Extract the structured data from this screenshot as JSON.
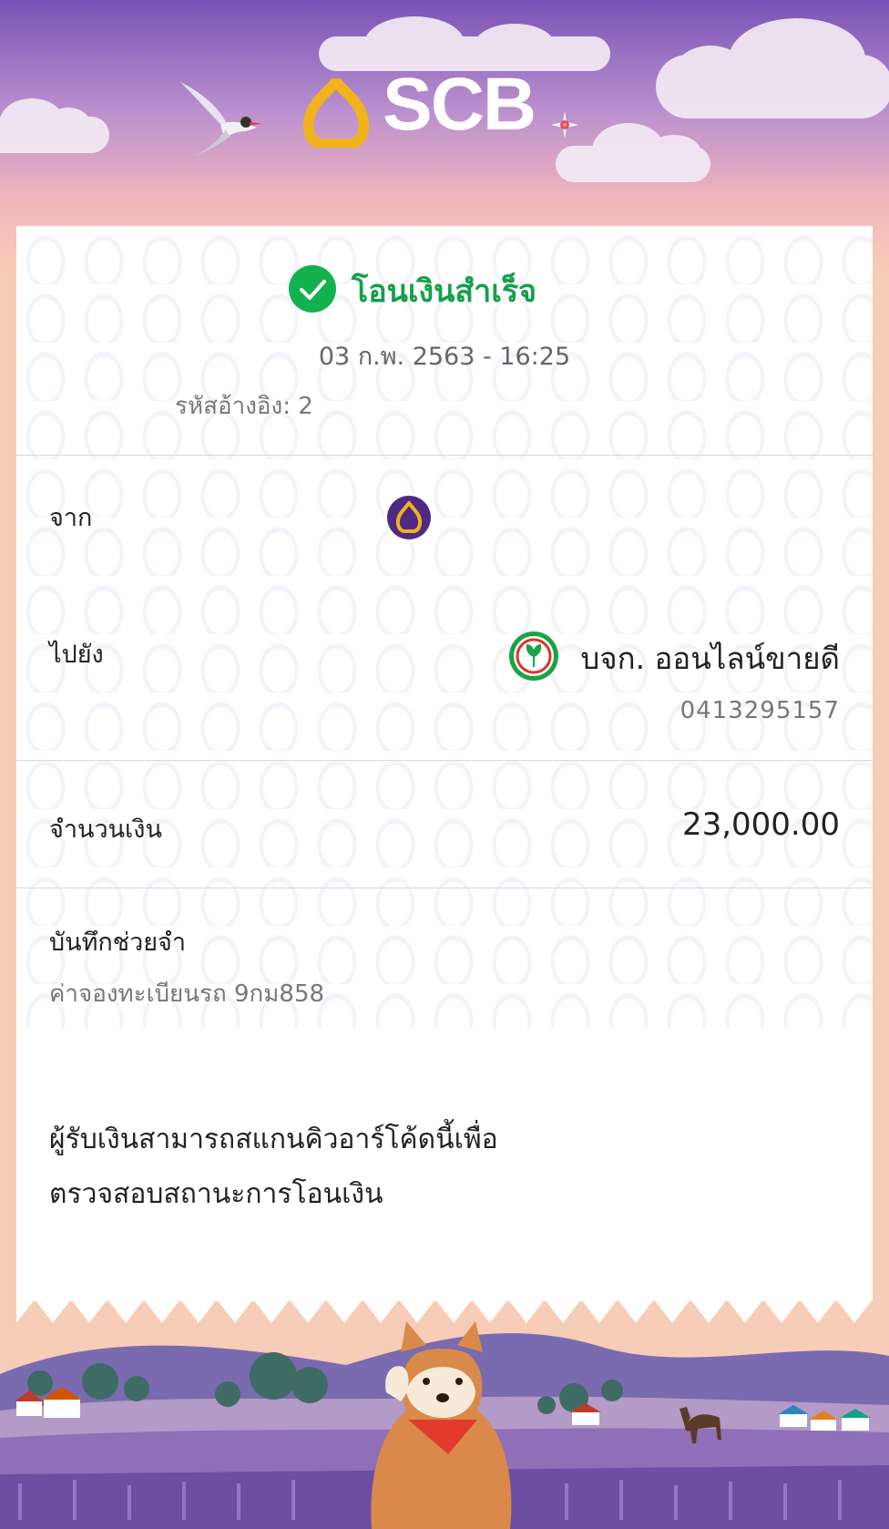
{
  "header": {
    "brand": "SCB",
    "colors": {
      "brand_purple": "#4e2a84",
      "brand_gold": "#f2b21b"
    }
  },
  "status": {
    "icon": "check-circle-icon",
    "title": "โอนเงินสำเร็จ",
    "datetime": "03 ก.พ. 2563 - 16:25",
    "reference_label": "รหัสอ้างอิง: 2",
    "color": "#14a04a"
  },
  "from": {
    "label": "จาก",
    "bank_icon": "scb-bank-icon"
  },
  "to": {
    "label": "ไปยัง",
    "bank_icon": "kbank-icon",
    "name": "บจก. ออนไลน์ขายดี",
    "account": "0413295157"
  },
  "amount": {
    "label": "จำนวนเงิน",
    "value": "23,000.00"
  },
  "memo": {
    "label": "บันทึกช่วยจำ",
    "text": "ค่าจองทะเบียนรถ 9กม858"
  },
  "qr_note": {
    "line1": "ผู้รับเงินสามารถสแกนคิวอาร์โค้ดนี้เพื่อ",
    "line2": "ตรวจสอบสถานะการโอนเงิน"
  }
}
